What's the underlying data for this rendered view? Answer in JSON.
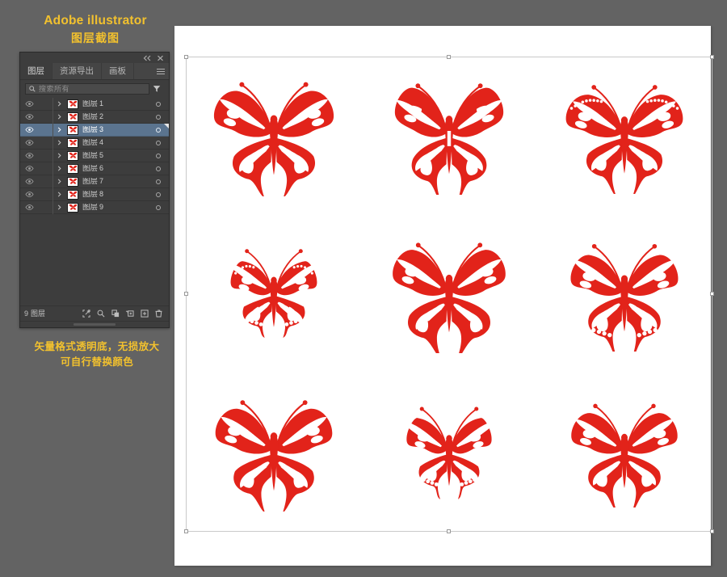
{
  "title": {
    "main": "Adobe illustrator",
    "sub": "图层截图"
  },
  "caption": {
    "line1": "矢量格式透明底，无损放大",
    "line2": "可自行替换颜色"
  },
  "colors": {
    "app_background": "#636363",
    "panel_background": "#3d3d3d",
    "panel_tabbar": "#454545",
    "accent_yellow": "#f2c12e",
    "selection_blue": "#5b748f",
    "artwork_red": "#E2231A",
    "canvas_white": "#ffffff",
    "selection_outline": "#c9c9c9"
  },
  "panel": {
    "topbar": {
      "collapse_icon": "double-chevron-left-icon",
      "close_icon": "close-icon"
    },
    "tabs": [
      {
        "label": "图层",
        "active": true
      },
      {
        "label": "资源导出",
        "active": false
      },
      {
        "label": "画板",
        "active": false
      }
    ],
    "menu_icon": "panel-menu-icon",
    "search": {
      "icon": "search-icon",
      "placeholder": "搜索所有",
      "value": "",
      "filter_icon": "filter-icon"
    },
    "layers": [
      {
        "name": "图层",
        "number": "1",
        "visible": true,
        "locked": false,
        "selected": false,
        "expand_icon": "chevron-right-icon",
        "thumbnail": "butterfly-thumbnail"
      },
      {
        "name": "图层",
        "number": "2",
        "visible": true,
        "locked": false,
        "selected": false,
        "expand_icon": "chevron-right-icon",
        "thumbnail": "butterfly-thumbnail"
      },
      {
        "name": "图层",
        "number": "3",
        "visible": true,
        "locked": false,
        "selected": true,
        "expand_icon": "chevron-right-icon",
        "thumbnail": "butterfly-thumbnail"
      },
      {
        "name": "图层",
        "number": "4",
        "visible": true,
        "locked": false,
        "selected": false,
        "expand_icon": "chevron-right-icon",
        "thumbnail": "butterfly-thumbnail"
      },
      {
        "name": "图层",
        "number": "5",
        "visible": true,
        "locked": false,
        "selected": false,
        "expand_icon": "chevron-right-icon",
        "thumbnail": "butterfly-thumbnail"
      },
      {
        "name": "图层",
        "number": "6",
        "visible": true,
        "locked": false,
        "selected": false,
        "expand_icon": "chevron-right-icon",
        "thumbnail": "butterfly-thumbnail"
      },
      {
        "name": "图层",
        "number": "7",
        "visible": true,
        "locked": false,
        "selected": false,
        "expand_icon": "chevron-right-icon",
        "thumbnail": "butterfly-thumbnail"
      },
      {
        "name": "图层",
        "number": "8",
        "visible": true,
        "locked": false,
        "selected": false,
        "expand_icon": "chevron-right-icon",
        "thumbnail": "butterfly-thumbnail"
      },
      {
        "name": "图层",
        "number": "9",
        "visible": true,
        "locked": false,
        "selected": false,
        "expand_icon": "chevron-right-icon",
        "thumbnail": "butterfly-thumbnail"
      }
    ],
    "footer": {
      "count": "9",
      "count_label": "图层",
      "icons": [
        "locate-object-icon",
        "search-icon",
        "make-clipping-mask-icon",
        "new-sublayer-icon",
        "new-layer-icon",
        "delete-layer-icon"
      ]
    }
  },
  "canvas": {
    "artwork_name": "butterfly-artwork",
    "selection_active": true,
    "rows": 3,
    "columns": 3,
    "items": [
      {
        "id": "butterfly-1",
        "variant": "wide-wing-ornate"
      },
      {
        "id": "butterfly-2",
        "variant": "striped-long-antenna"
      },
      {
        "id": "butterfly-3",
        "variant": "dotted-edge-swirl"
      },
      {
        "id": "butterfly-4",
        "variant": "scalloped-small"
      },
      {
        "id": "butterfly-5",
        "variant": "banded-broad"
      },
      {
        "id": "butterfly-6",
        "variant": "curled-tail-ornate"
      },
      {
        "id": "butterfly-7",
        "variant": "layered-petal"
      },
      {
        "id": "butterfly-8",
        "variant": "round-wing-soft"
      },
      {
        "id": "butterfly-9",
        "variant": "flared-swirl"
      }
    ]
  }
}
